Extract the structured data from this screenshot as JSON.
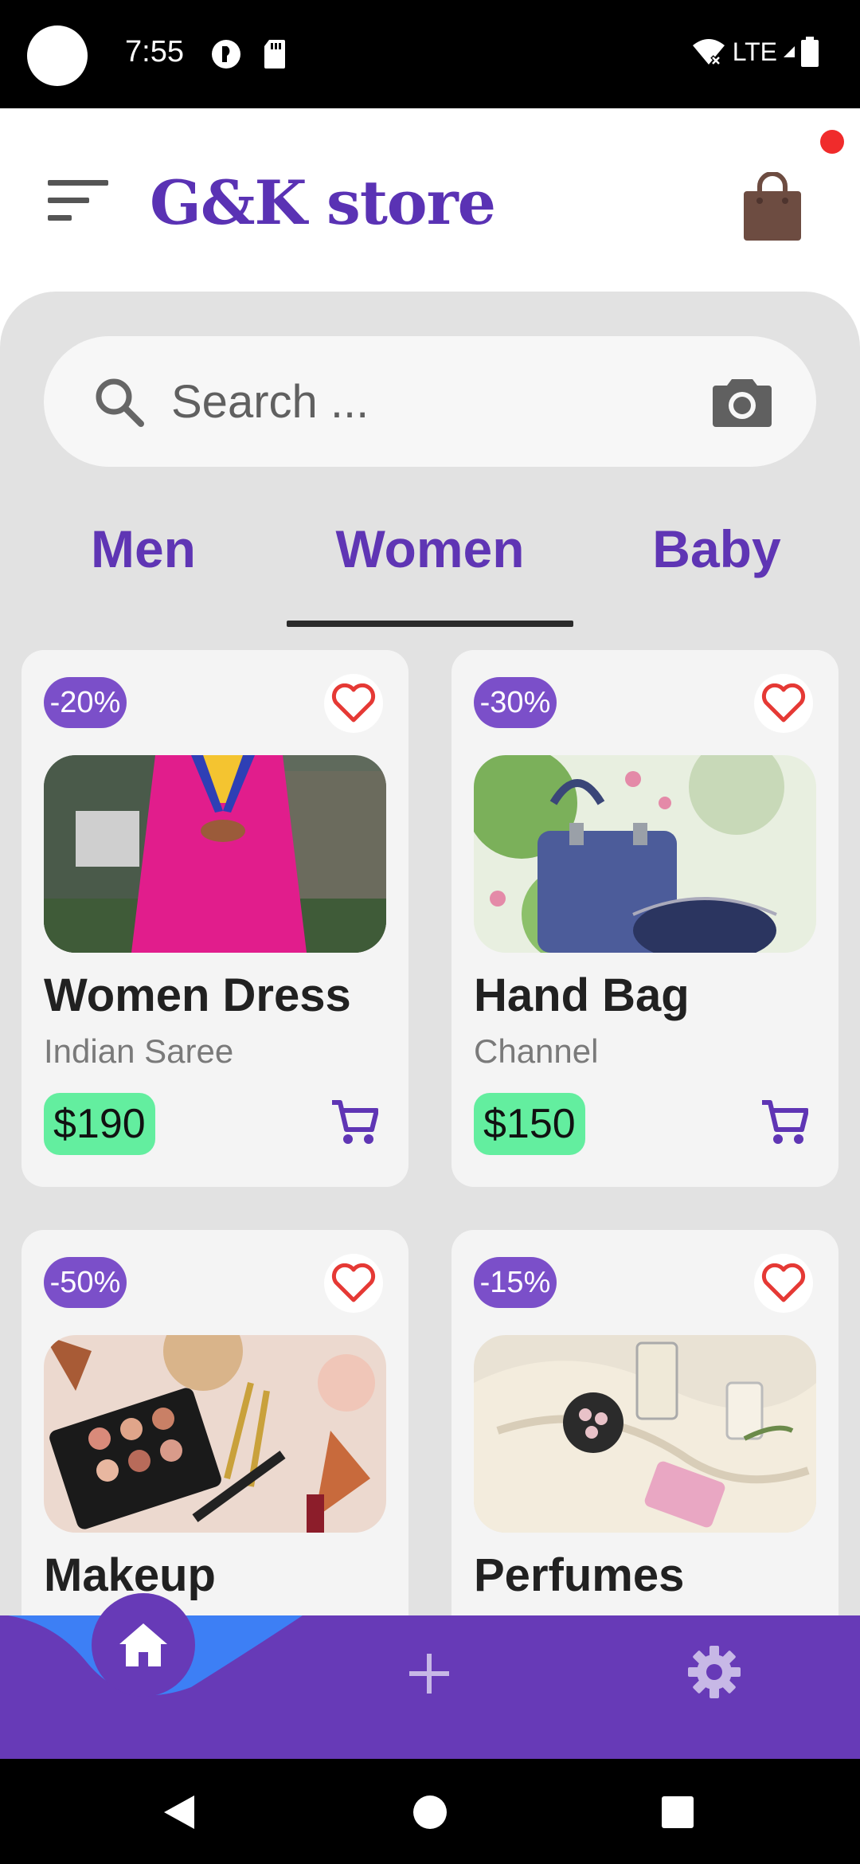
{
  "status_bar": {
    "time": "7:55",
    "network": "LTE"
  },
  "app_bar": {
    "title": "G&K store"
  },
  "search": {
    "placeholder": "Search ..."
  },
  "tabs": [
    {
      "label": "Men"
    },
    {
      "label": "Women",
      "selected": true
    },
    {
      "label": "Baby"
    }
  ],
  "products": [
    {
      "discount": "-20%",
      "name": "Women Dress",
      "brand": "Indian Saree",
      "price": "$190"
    },
    {
      "discount": "-30%",
      "name": "Hand Bag",
      "brand": "Channel",
      "price": "$150"
    },
    {
      "discount": "-50%",
      "name": "Makeup",
      "brand": "",
      "price": ""
    },
    {
      "discount": "-15%",
      "name": "Perfumes",
      "brand": "",
      "price": ""
    }
  ],
  "bottom_nav": {
    "items": [
      "home-icon",
      "add-icon",
      "settings-icon"
    ],
    "active": "home-icon"
  },
  "colors": {
    "accent": "#673ab7",
    "brand_text": "#5a32b4",
    "price_bg": "#63ee9f",
    "badge_bg": "#7b4fc9",
    "heart": "#e53935",
    "notification": "#f02b2b",
    "home_wave": "#3d7ff5"
  }
}
